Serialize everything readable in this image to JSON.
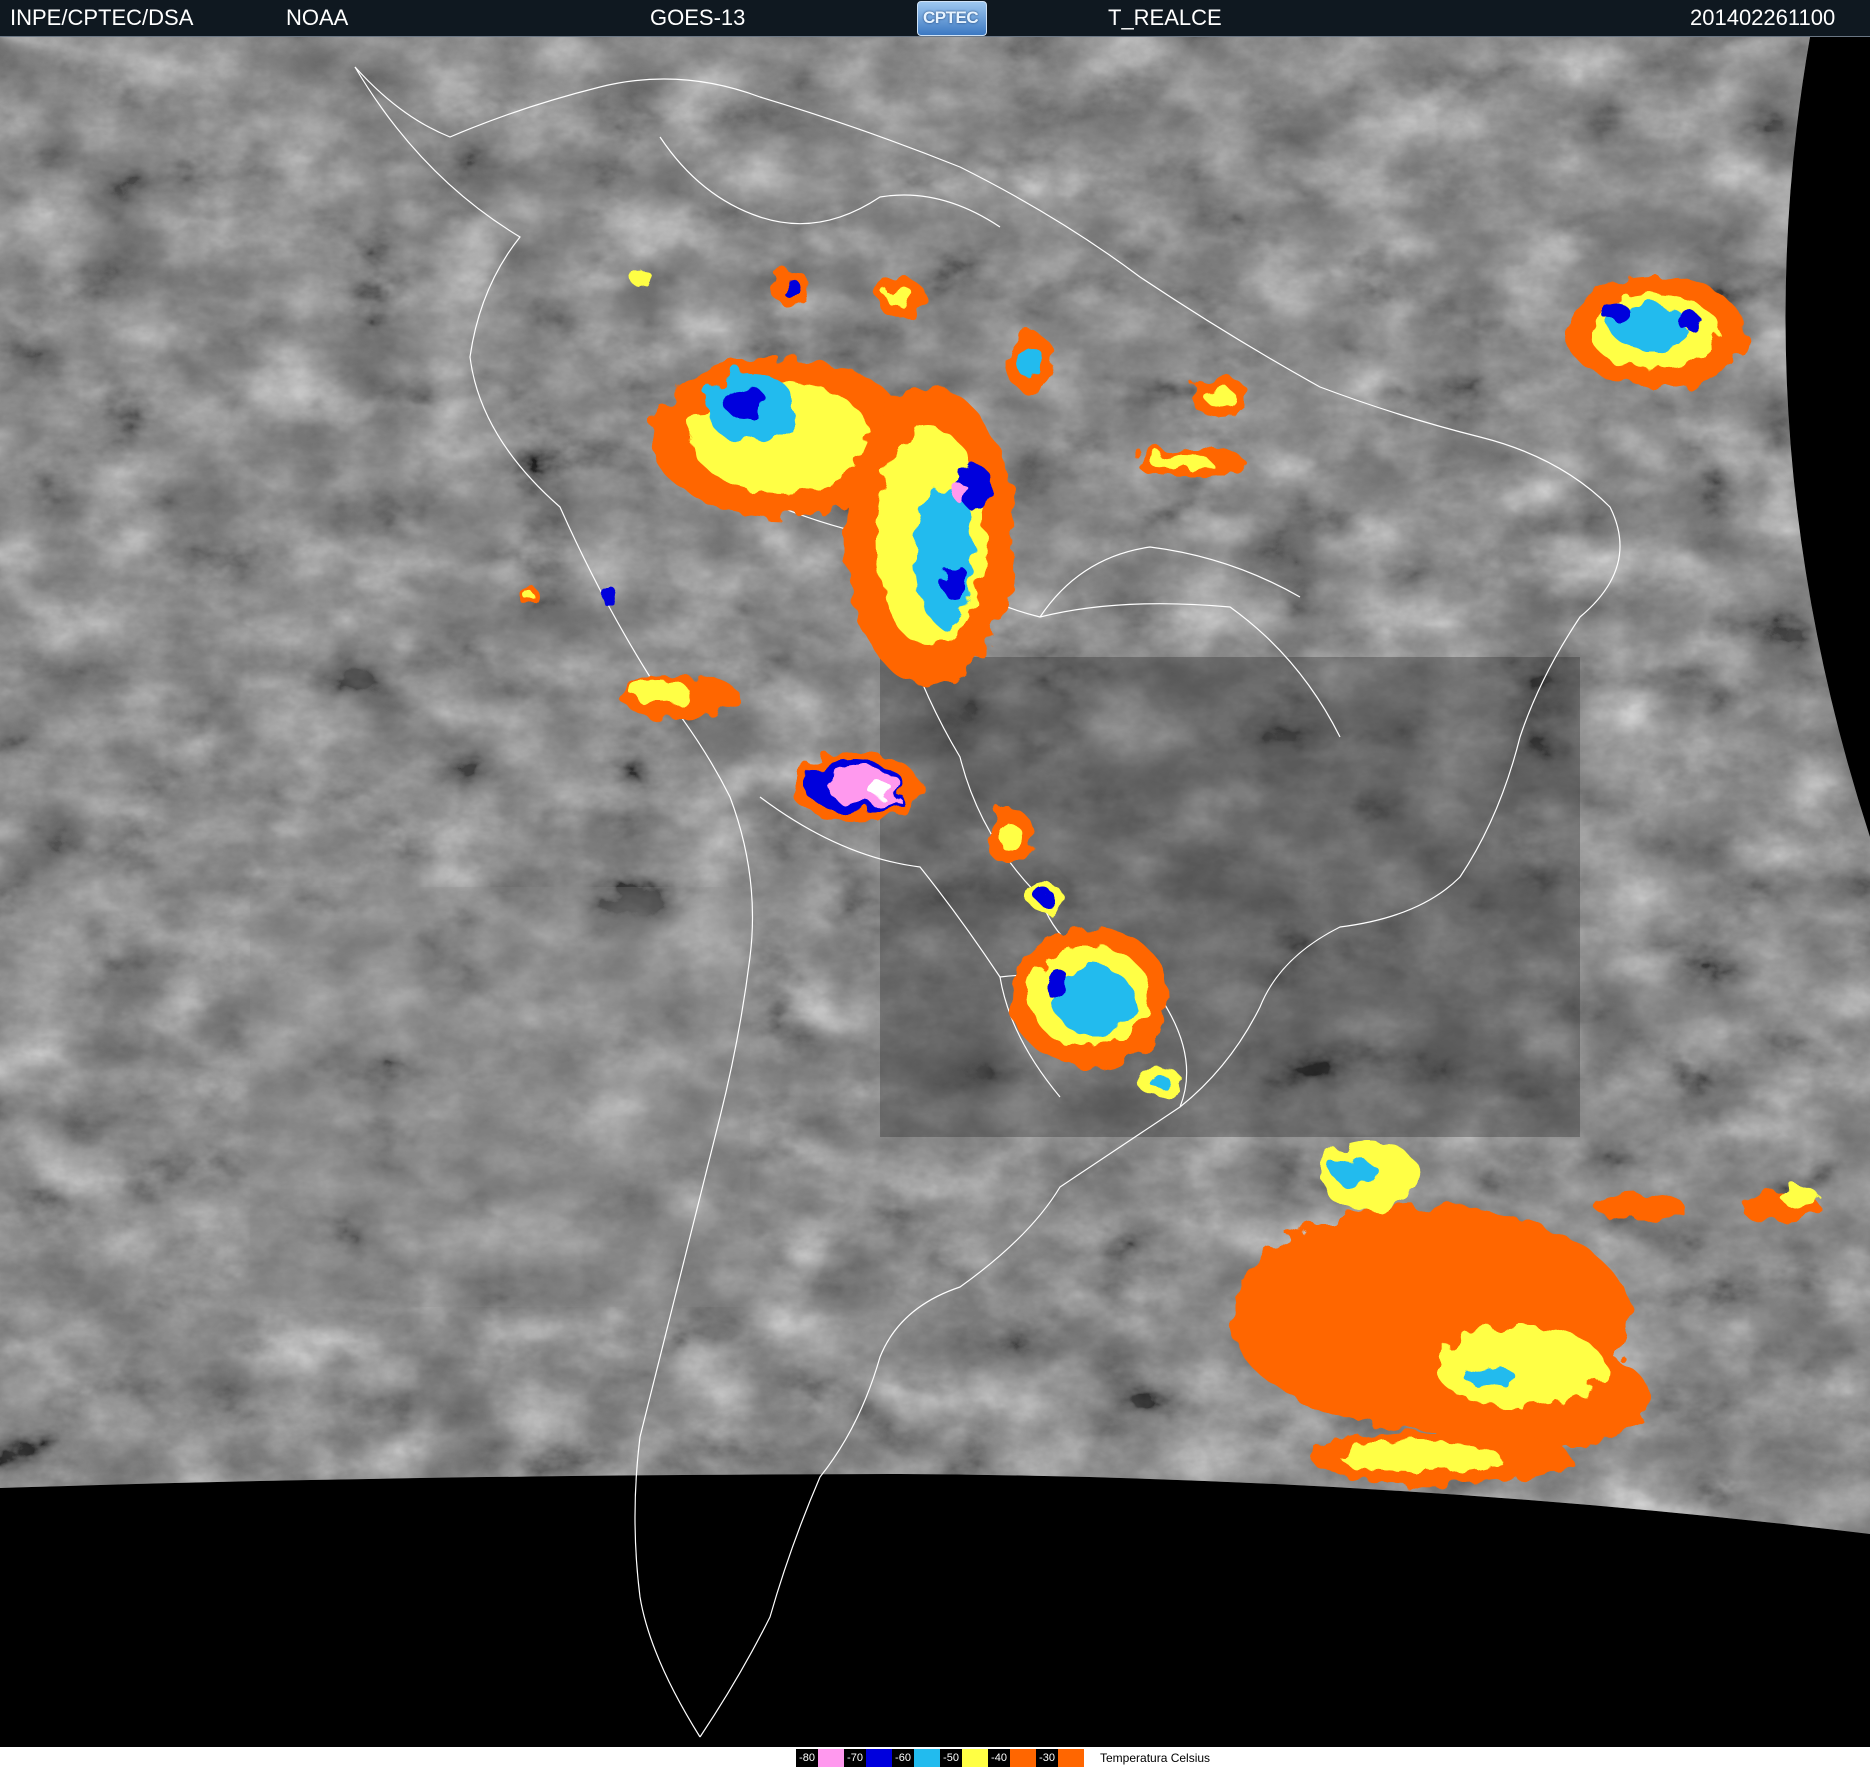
{
  "header": {
    "left_label": "INPE/CPTEC/DSA",
    "agency": "NOAA",
    "satellite": "GOES-13",
    "logo_text": "CPTEC",
    "product": "T_REALCE",
    "timestamp": "201402261100"
  },
  "legend": {
    "title": "Temperatura Celsius",
    "entries": [
      {
        "label": "-80",
        "color": "#ff99ee"
      },
      {
        "label": "-70",
        "color": "#0000dd"
      },
      {
        "label": "-60",
        "color": "#22bbee"
      },
      {
        "label": "-50",
        "color": "#ffff44"
      },
      {
        "label": "-40",
        "color": "#ff6600"
      },
      {
        "label": "-30",
        "color": "#ff6600"
      }
    ]
  },
  "colors": {
    "space": "#000000",
    "cloud_gray": "#6e6e6e",
    "coastline": "#ffffff"
  }
}
